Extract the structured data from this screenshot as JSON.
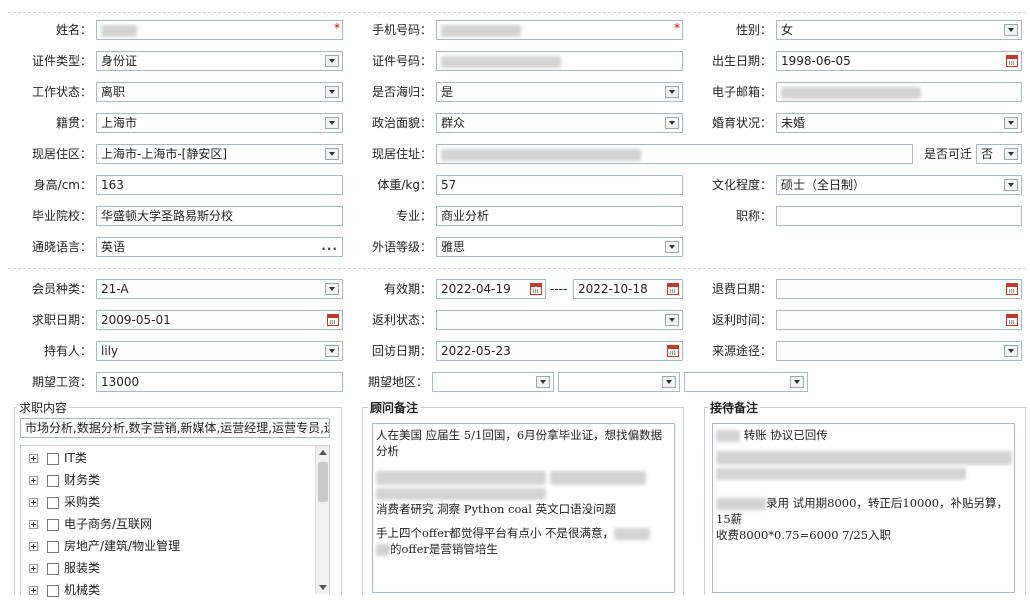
{
  "personal": {
    "name_label": "姓名：",
    "phone_label": "手机号码：",
    "gender_label": "性别：",
    "gender_value": "女",
    "id_type_label": "证件类型：",
    "id_type_value": "身份证",
    "id_number_label": "证件号码：",
    "birth_label": "出生日期：",
    "birth_value": "1998-06-05",
    "work_status_label": "工作状态：",
    "work_status_value": "离职",
    "overseas_label": "是否海归：",
    "overseas_value": "是",
    "email_label": "电子邮箱：",
    "native_label": "籍贯：",
    "native_value": "上海市",
    "political_label": "政治面貌：",
    "political_value": "群众",
    "marital_label": "婚育状况：",
    "marital_value": "未婚",
    "residence_area_label": "现居住区：",
    "residence_area_value": "上海市-上海市-[静安区]",
    "address_label": "现居住址：",
    "relocate_label": "是否可迁",
    "relocate_value": "否",
    "height_label": "身高/cm：",
    "height_value": "163",
    "weight_label": "体重/kg：",
    "weight_value": "57",
    "education_label": "文化程度：",
    "education_value": "硕士（全日制）",
    "school_label": "毕业院校：",
    "school_value": "华盛顿大学圣路易斯分校",
    "major_label": "专业：",
    "major_value": "商业分析",
    "title_label": "职称：",
    "language_label": "通晓语言：",
    "language_value": "英语",
    "lang_level_label": "外语等级：",
    "lang_level_value": "雅思"
  },
  "membership": {
    "type_label": "会员种类：",
    "type_value": "21-A",
    "valid_label": "有效期：",
    "valid_from": "2022-04-19",
    "valid_sep": "----",
    "valid_to": "2022-10-18",
    "refund_date_label": "退费日期：",
    "apply_date_label": "求职日期：",
    "apply_date_value": "2009-05-01",
    "rebate_status_label": "返利状态：",
    "rebate_time_label": "返利时间：",
    "holder_label": "持有人：",
    "holder_value": "lily",
    "visit_date_label": "回访日期：",
    "visit_date_value": "2022-05-23",
    "source_label": "来源途径：",
    "salary_label": "期望工资：",
    "salary_value": "13000",
    "region_label": "期望地区："
  },
  "job_content": {
    "title": "求职内容",
    "summary": "市场分析,数据分析,数字营销,新媒体,运营经理,运营专员,运",
    "categories": [
      "IT类",
      "财务类",
      "采购类",
      "电子商务/互联网",
      "房地产/建筑/物业管理",
      "服装类",
      "机械类"
    ]
  },
  "consultant_notes": {
    "title": "顾问备注",
    "line1": "人在美国  应届生 5/1回国，6月份拿毕业证，想找偏数据分析",
    "line2": " 消费者研究  洞察    Python coal   英文口语没问题",
    "line3": "手上四个offer都觉得平台有点小  不是很满意，",
    "line4": "的offer是营销管培生"
  },
  "reception_notes": {
    "title": "接待备注",
    "line1": "转账 协议已回传",
    "line2": "录用 试用期8000，转正后10000，补贴另算，15薪",
    "line3": "收费8000*0.75=6000  7/25入职"
  }
}
